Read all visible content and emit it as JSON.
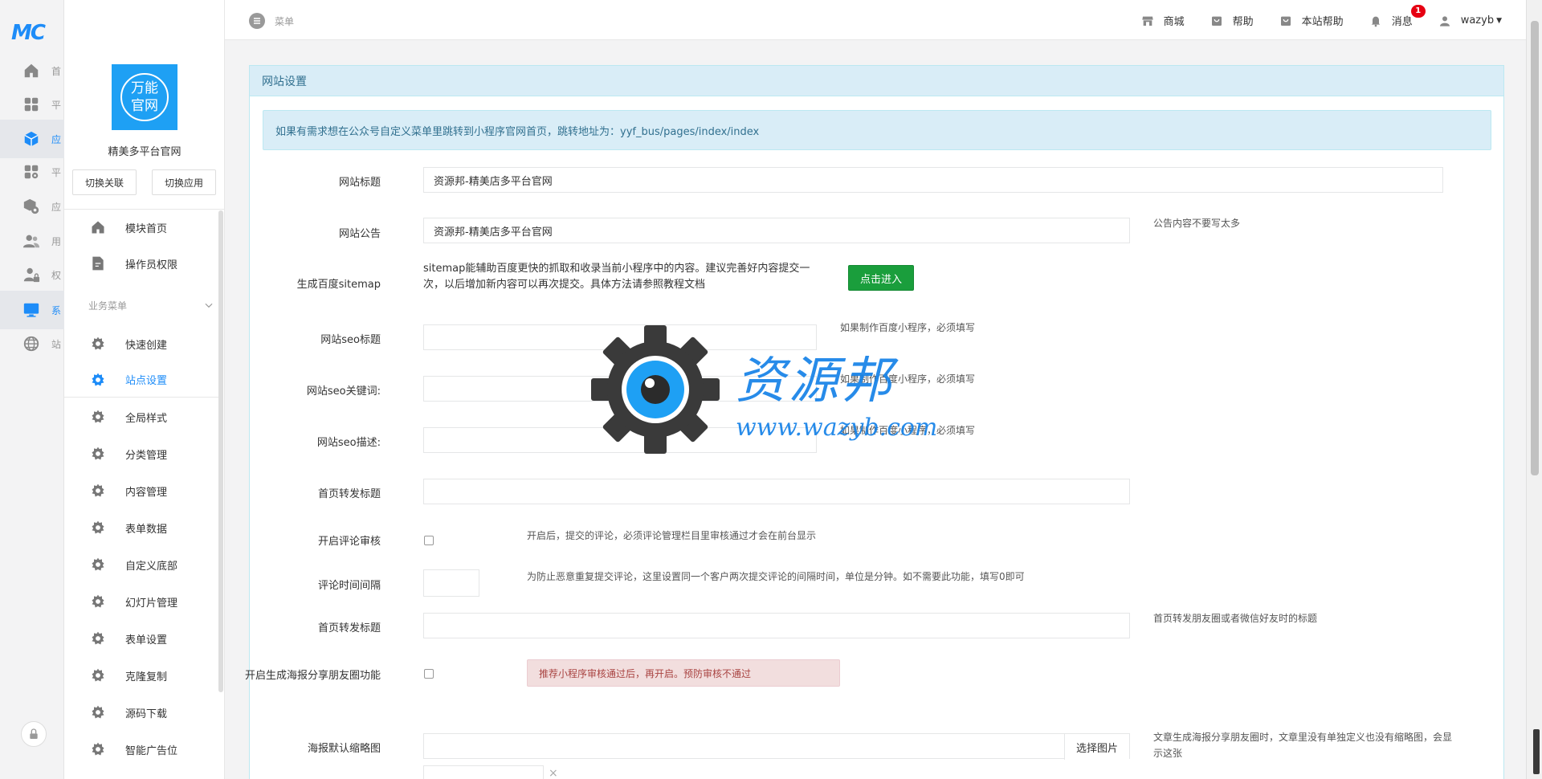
{
  "rail": {
    "logo": "MC",
    "items": [
      {
        "label": "首",
        "icon": "home-icon"
      },
      {
        "label": "平",
        "icon": "grid-icon"
      },
      {
        "label": "应",
        "icon": "cube-icon",
        "active": true
      },
      {
        "label": "平",
        "icon": "apps-gear-icon"
      },
      {
        "label": "应",
        "icon": "box-gear-icon"
      },
      {
        "label": "用",
        "icon": "users-icon"
      },
      {
        "label": "权",
        "icon": "user-lock-icon"
      },
      {
        "label": "系",
        "icon": "monitor-icon",
        "active": true
      },
      {
        "label": "站",
        "icon": "globe-icon"
      }
    ]
  },
  "sidebar": {
    "logo_line1": "万能",
    "logo_line2": "官网",
    "app_name": "精美多平台官网",
    "switch_link_label": "切换关联",
    "switch_app_label": "切换应用",
    "items_top": [
      {
        "label": "模块首页",
        "icon": "home-icon"
      },
      {
        "label": "操作员权限",
        "icon": "document-edit-icon"
      }
    ],
    "group_label": "业务菜单",
    "items": [
      {
        "label": "快速创建"
      },
      {
        "label": "站点设置",
        "active": true
      },
      {
        "label": "全局样式"
      },
      {
        "label": "分类管理"
      },
      {
        "label": "内容管理"
      },
      {
        "label": "表单数据"
      },
      {
        "label": "自定义底部"
      },
      {
        "label": "幻灯片管理"
      },
      {
        "label": "表单设置"
      },
      {
        "label": "克隆复制"
      },
      {
        "label": "源码下载"
      },
      {
        "label": "智能广告位"
      }
    ]
  },
  "topbar": {
    "menu_label": "菜单",
    "nav": {
      "shop": "商城",
      "help": "帮助",
      "site_help": "本站帮助",
      "messages": "消息",
      "messages_badge": "1",
      "user": "wazyb"
    }
  },
  "panel": {
    "title": "网站设置",
    "info_text": "如果有需求想在公众号自定义菜单里跳转到小程序官网首页，跳转地址为：yyf_bus/pages/index/index",
    "fields": {
      "site_title": {
        "label": "网站标题",
        "value": "资源邦-精美店多平台官网"
      },
      "site_notice": {
        "label": "网站公告",
        "value": "资源邦-精美店多平台官网",
        "help": "公告内容不要写太多"
      },
      "sitemap": {
        "label": "生成百度sitemap",
        "desc": "sitemap能辅助百度更快的抓取和收录当前小程序中的内容。建议完善好内容提交一次，以后增加新内容可以再次提交。具体方法请参照教程文档",
        "button": "点击进入"
      },
      "seo_title": {
        "label": "网站seo标题",
        "value": "",
        "help": "如果制作百度小程序，必须填写"
      },
      "seo_keywords": {
        "label": "网站seo关键词:",
        "value": "",
        "help": "如果制作百度小程序，必须填写"
      },
      "seo_desc": {
        "label": "网站seo描述:",
        "value": "",
        "help": "如果制作百度小程序，必须填写"
      },
      "share_title": {
        "label": "首页转发标题",
        "value": ""
      },
      "comment_review": {
        "label": "开启评论审核",
        "help": "开启后，提交的评论，必须评论管理栏目里审核通过才会在前台显示"
      },
      "comment_interval": {
        "label": "评论时间间隔",
        "value": "",
        "help": "为防止恶意重复提交评论，这里设置同一个客户两次提交评论的间隔时间，单位是分钟。如不需要此功能，填写0即可"
      },
      "share_title2": {
        "label": "首页转发标题",
        "value": "",
        "help": "首页转发朋友圈或者微信好友时的标题"
      },
      "poster_share": {
        "label": "开启生成海报分享朋友圈功能",
        "warning": "推荐小程序审核通过后，再开启。预防审核不通过"
      },
      "poster_thumb": {
        "label": "海报默认缩略图",
        "value": "",
        "button": "选择图片",
        "help": "文章生成海报分享朋友圈时，文章里没有单独定义也没有缩略图，会显示这张"
      }
    }
  },
  "watermark": {
    "title": "资源邦",
    "url": "www.wazyb.com"
  },
  "colors": {
    "accent": "#1d8cf8",
    "info_bg": "#d9edf7",
    "info_text": "#31708f",
    "success": "#1a9e3c",
    "danger_bg": "#f2dede",
    "danger_text": "#a94442",
    "badge": "#e60012"
  }
}
